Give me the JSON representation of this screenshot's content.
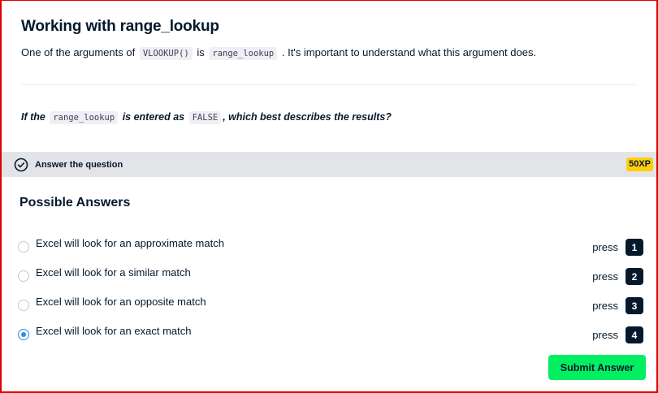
{
  "exercise": {
    "title": "Working with range_lookup",
    "lead_pre": "One of the arguments of",
    "lead_code1": "VLOOKUP()",
    "lead_mid": "is",
    "lead_code2": "range_lookup",
    "lead_post": ". It's important to understand what this argument does.",
    "question_pre": "If the",
    "question_code1": "range_lookup",
    "question_mid": "is entered as",
    "question_code2": "FALSE",
    "question_post": ", which best describes the results?"
  },
  "task_bar": {
    "icon": "check-circle-icon",
    "label": "Answer the question",
    "xp": "50XP",
    "xp_color": "#fcce0d"
  },
  "answers": {
    "heading": "Possible Answers",
    "press_label": "press",
    "selected_index": 4,
    "options": [
      {
        "text": "Excel will look for an approximate match",
        "key": "1"
      },
      {
        "text": "Excel will look for a similar match",
        "key": "2"
      },
      {
        "text": "Excel will look for an opposite match",
        "key": "3"
      },
      {
        "text": "Excel will look for an exact match",
        "key": "4"
      }
    ]
  },
  "submit": {
    "label": "Submit Answer",
    "color": "#03ef62"
  }
}
